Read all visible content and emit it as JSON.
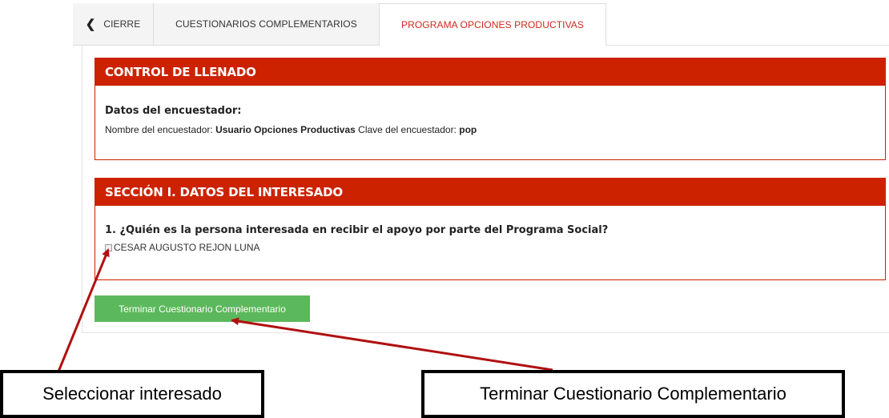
{
  "tabs": {
    "cierre": "CIERRE",
    "cuestionarios": "CUESTIONARIOS COMPLEMENTARIOS",
    "programa": "PROGRAMA OPCIONES PRODUCTIVAS",
    "active": "programa"
  },
  "control": {
    "title": "CONTROL DE LLENADO",
    "subtitle": "Datos del encuestador:",
    "name_label": "Nombre del encuestador:",
    "name_value": "Usuario Opciones Productivas",
    "key_label": "Clave del encuestador:",
    "key_value": "pop"
  },
  "section1": {
    "title": "SECCIÓN I. DATOS DEL INTERESADO",
    "question": "1. ¿Quién es la persona interesada en recibir el apoyo por parte del Programa Social?",
    "options": [
      {
        "label": "CESAR AUGUSTO REJON LUNA",
        "checked": false
      }
    ]
  },
  "finish_button": "Terminar Cuestionario Complementario",
  "annotations": {
    "select": "Seleccionar interesado",
    "finish": "Terminar Cuestionario Complementario"
  },
  "colors": {
    "panel_header": "#cc2200",
    "active_tab_text": "#cc2a1a",
    "finish_button": "#5cb85c",
    "arrow": "#b01010"
  }
}
